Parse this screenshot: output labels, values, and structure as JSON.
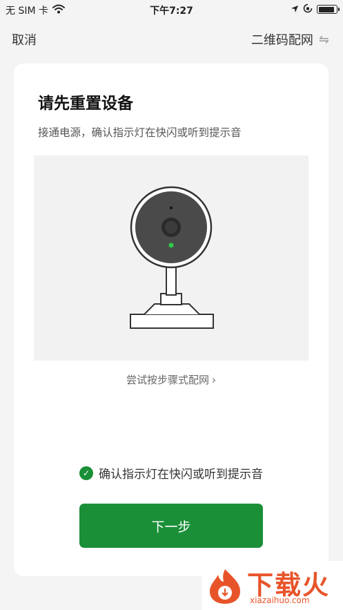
{
  "status_bar": {
    "carrier": "无 SIM 卡",
    "time": "下午7:27",
    "battery_level": 0.9
  },
  "nav": {
    "cancel": "取消",
    "qr_config": "二维码配网"
  },
  "card": {
    "title": "请先重置设备",
    "subtitle": "接通电源，确认指示灯在快闪或听到提示音",
    "step_link": "尝试按步骤式配网",
    "confirm_text": "确认指示灯在快闪或听到提示音",
    "next_button": "下一步"
  },
  "watermark": {
    "brand": "下载火",
    "domain": "xiazaihuo.com"
  },
  "colors": {
    "accent": "#1a8f38",
    "brand_orange": "#e8542a"
  }
}
